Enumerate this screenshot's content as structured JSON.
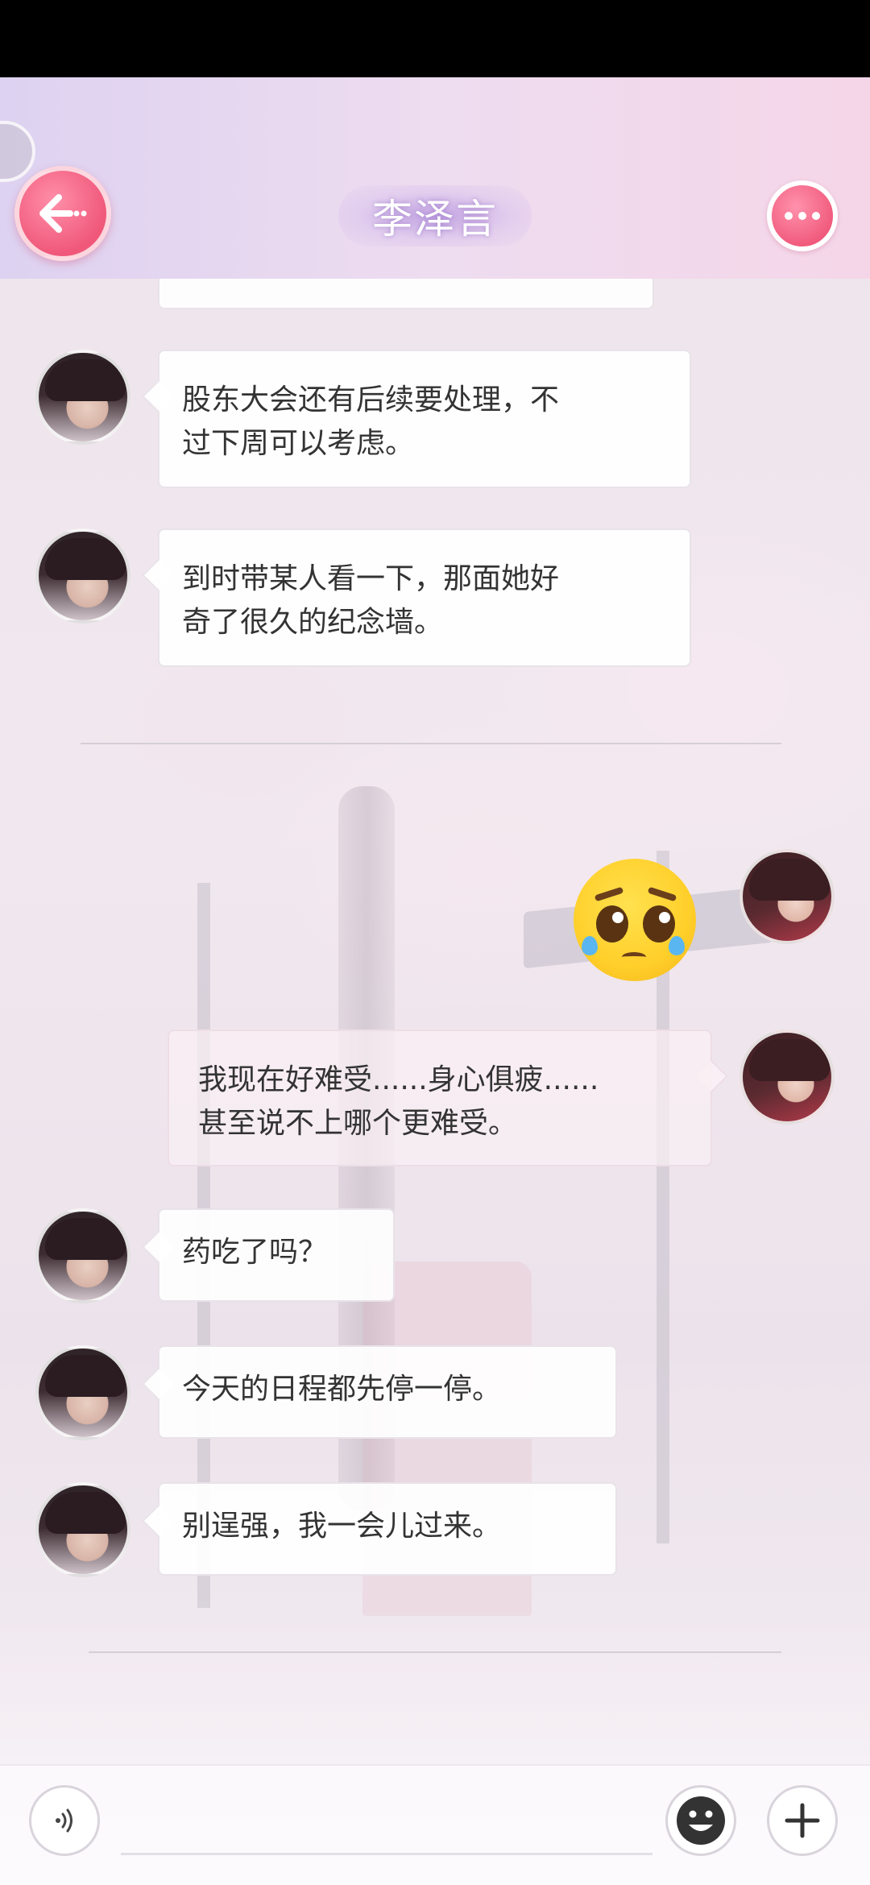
{
  "header": {
    "title": "李泽言",
    "back_icon": "arrow-left-icon",
    "more_icon": "more-dots-icon",
    "accent_color": "#f0587a"
  },
  "messages": [
    {
      "sender": "李泽言",
      "side": "left",
      "text": "股东大会还有后续要处理，不过下周可以考虑。"
    },
    {
      "sender": "李泽言",
      "side": "left",
      "text": "到时带某人看一下，那面她好奇了很久的纪念墙。"
    },
    {
      "sender": "me",
      "side": "right",
      "type": "emoji",
      "emoji": "pleading-face"
    },
    {
      "sender": "me",
      "side": "right",
      "text": "我现在好难受……身心俱疲……甚至说不上哪个更难受。"
    },
    {
      "sender": "李泽言",
      "side": "left",
      "text": "药吃了吗？"
    },
    {
      "sender": "李泽言",
      "side": "left",
      "text": "今天的日程都先停一停。"
    },
    {
      "sender": "李泽言",
      "side": "left",
      "text": "别逞强，我一会儿过来。"
    }
  ],
  "bubble_lines": {
    "m0": [
      "股东大会还有后续要处理，不",
      "过下周可以考虑。"
    ],
    "m1": [
      "到时带某人看一下，那面她好",
      "奇了很久的纪念墙。"
    ],
    "m3": [
      "我现在好难受......身心俱疲......",
      "甚至说不上哪个更难受。"
    ]
  },
  "input_bar": {
    "voice_icon": "voice-icon",
    "emoji_icon": "emoji-face-icon",
    "plus_icon": "plus-icon"
  }
}
